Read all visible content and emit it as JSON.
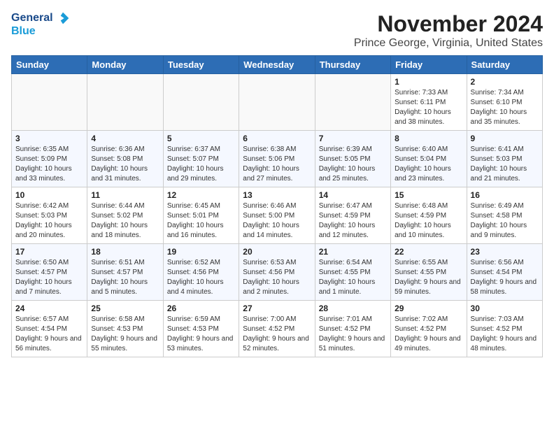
{
  "header": {
    "logo_general": "General",
    "logo_blue": "Blue",
    "month_title": "November 2024",
    "location": "Prince George, Virginia, United States"
  },
  "days_of_week": [
    "Sunday",
    "Monday",
    "Tuesday",
    "Wednesday",
    "Thursday",
    "Friday",
    "Saturday"
  ],
  "weeks": [
    [
      {
        "day": "",
        "info": ""
      },
      {
        "day": "",
        "info": ""
      },
      {
        "day": "",
        "info": ""
      },
      {
        "day": "",
        "info": ""
      },
      {
        "day": "",
        "info": ""
      },
      {
        "day": "1",
        "info": "Sunrise: 7:33 AM\nSunset: 6:11 PM\nDaylight: 10 hours and 38 minutes."
      },
      {
        "day": "2",
        "info": "Sunrise: 7:34 AM\nSunset: 6:10 PM\nDaylight: 10 hours and 35 minutes."
      }
    ],
    [
      {
        "day": "3",
        "info": "Sunrise: 6:35 AM\nSunset: 5:09 PM\nDaylight: 10 hours and 33 minutes."
      },
      {
        "day": "4",
        "info": "Sunrise: 6:36 AM\nSunset: 5:08 PM\nDaylight: 10 hours and 31 minutes."
      },
      {
        "day": "5",
        "info": "Sunrise: 6:37 AM\nSunset: 5:07 PM\nDaylight: 10 hours and 29 minutes."
      },
      {
        "day": "6",
        "info": "Sunrise: 6:38 AM\nSunset: 5:06 PM\nDaylight: 10 hours and 27 minutes."
      },
      {
        "day": "7",
        "info": "Sunrise: 6:39 AM\nSunset: 5:05 PM\nDaylight: 10 hours and 25 minutes."
      },
      {
        "day": "8",
        "info": "Sunrise: 6:40 AM\nSunset: 5:04 PM\nDaylight: 10 hours and 23 minutes."
      },
      {
        "day": "9",
        "info": "Sunrise: 6:41 AM\nSunset: 5:03 PM\nDaylight: 10 hours and 21 minutes."
      }
    ],
    [
      {
        "day": "10",
        "info": "Sunrise: 6:42 AM\nSunset: 5:03 PM\nDaylight: 10 hours and 20 minutes."
      },
      {
        "day": "11",
        "info": "Sunrise: 6:44 AM\nSunset: 5:02 PM\nDaylight: 10 hours and 18 minutes."
      },
      {
        "day": "12",
        "info": "Sunrise: 6:45 AM\nSunset: 5:01 PM\nDaylight: 10 hours and 16 minutes."
      },
      {
        "day": "13",
        "info": "Sunrise: 6:46 AM\nSunset: 5:00 PM\nDaylight: 10 hours and 14 minutes."
      },
      {
        "day": "14",
        "info": "Sunrise: 6:47 AM\nSunset: 4:59 PM\nDaylight: 10 hours and 12 minutes."
      },
      {
        "day": "15",
        "info": "Sunrise: 6:48 AM\nSunset: 4:59 PM\nDaylight: 10 hours and 10 minutes."
      },
      {
        "day": "16",
        "info": "Sunrise: 6:49 AM\nSunset: 4:58 PM\nDaylight: 10 hours and 9 minutes."
      }
    ],
    [
      {
        "day": "17",
        "info": "Sunrise: 6:50 AM\nSunset: 4:57 PM\nDaylight: 10 hours and 7 minutes."
      },
      {
        "day": "18",
        "info": "Sunrise: 6:51 AM\nSunset: 4:57 PM\nDaylight: 10 hours and 5 minutes."
      },
      {
        "day": "19",
        "info": "Sunrise: 6:52 AM\nSunset: 4:56 PM\nDaylight: 10 hours and 4 minutes."
      },
      {
        "day": "20",
        "info": "Sunrise: 6:53 AM\nSunset: 4:56 PM\nDaylight: 10 hours and 2 minutes."
      },
      {
        "day": "21",
        "info": "Sunrise: 6:54 AM\nSunset: 4:55 PM\nDaylight: 10 hours and 1 minute."
      },
      {
        "day": "22",
        "info": "Sunrise: 6:55 AM\nSunset: 4:55 PM\nDaylight: 9 hours and 59 minutes."
      },
      {
        "day": "23",
        "info": "Sunrise: 6:56 AM\nSunset: 4:54 PM\nDaylight: 9 hours and 58 minutes."
      }
    ],
    [
      {
        "day": "24",
        "info": "Sunrise: 6:57 AM\nSunset: 4:54 PM\nDaylight: 9 hours and 56 minutes."
      },
      {
        "day": "25",
        "info": "Sunrise: 6:58 AM\nSunset: 4:53 PM\nDaylight: 9 hours and 55 minutes."
      },
      {
        "day": "26",
        "info": "Sunrise: 6:59 AM\nSunset: 4:53 PM\nDaylight: 9 hours and 53 minutes."
      },
      {
        "day": "27",
        "info": "Sunrise: 7:00 AM\nSunset: 4:52 PM\nDaylight: 9 hours and 52 minutes."
      },
      {
        "day": "28",
        "info": "Sunrise: 7:01 AM\nSunset: 4:52 PM\nDaylight: 9 hours and 51 minutes."
      },
      {
        "day": "29",
        "info": "Sunrise: 7:02 AM\nSunset: 4:52 PM\nDaylight: 9 hours and 49 minutes."
      },
      {
        "day": "30",
        "info": "Sunrise: 7:03 AM\nSunset: 4:52 PM\nDaylight: 9 hours and 48 minutes."
      }
    ]
  ]
}
